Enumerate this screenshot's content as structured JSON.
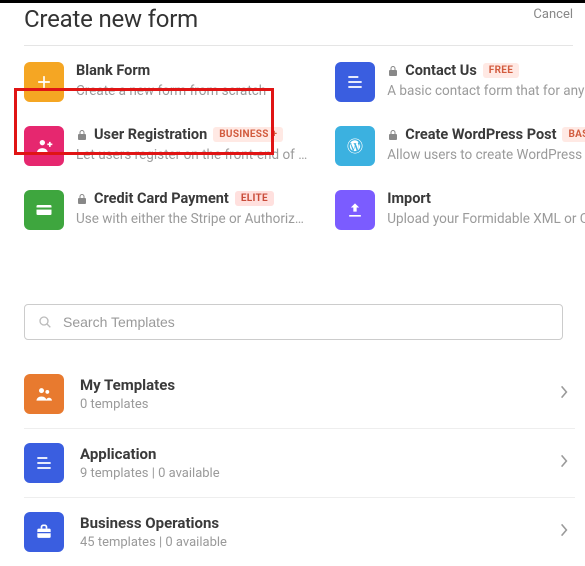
{
  "header": {
    "title": "Create new form",
    "cancel": "Cancel"
  },
  "search": {
    "placeholder": "Search Templates"
  },
  "cards": [
    {
      "title": "Blank Form",
      "desc": "Create a new form from scratch",
      "locked": false,
      "badge": null
    },
    {
      "title": "Contact Us",
      "desc": "A basic contact form that for any Wor…",
      "locked": true,
      "badge": "FREE"
    },
    {
      "title": "User Registration",
      "desc": "Let users register on the front-end of …",
      "locked": true,
      "badge": "BUSINESS +"
    },
    {
      "title": "Create WordPress Post",
      "desc": "Allow users to create WordPress post…",
      "locked": true,
      "badge": "BASIC +"
    },
    {
      "title": "Credit Card Payment",
      "desc": "Use with either the Stripe or Authoriz…",
      "locked": true,
      "badge": "ELITE"
    },
    {
      "title": "Import",
      "desc": "Upload your Formidable XML or CSV …",
      "locked": false,
      "badge": null
    }
  ],
  "categories": [
    {
      "title": "My Templates",
      "meta": "0 templates"
    },
    {
      "title": "Application",
      "meta": "9 templates  |  0 available"
    },
    {
      "title": "Business Operations",
      "meta": "45 templates  |  0 available"
    }
  ]
}
